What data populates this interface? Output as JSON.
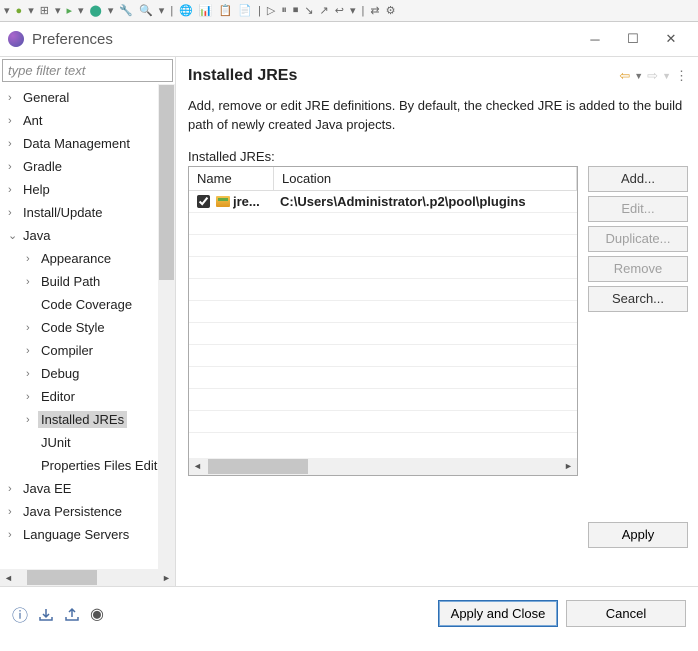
{
  "window": {
    "title": "Preferences"
  },
  "filter": {
    "placeholder": "type filter text"
  },
  "tree": {
    "items": [
      {
        "label": "General",
        "level": 0,
        "caret": ">"
      },
      {
        "label": "Ant",
        "level": 0,
        "caret": ">"
      },
      {
        "label": "Data Management",
        "level": 0,
        "caret": ">"
      },
      {
        "label": "Gradle",
        "level": 0,
        "caret": ">"
      },
      {
        "label": "Help",
        "level": 0,
        "caret": ">"
      },
      {
        "label": "Install/Update",
        "level": 0,
        "caret": ">"
      },
      {
        "label": "Java",
        "level": 0,
        "caret": "v",
        "expanded": true
      },
      {
        "label": "Appearance",
        "level": 1,
        "caret": ">"
      },
      {
        "label": "Build Path",
        "level": 1,
        "caret": ">"
      },
      {
        "label": "Code Coverage",
        "level": 1,
        "caret": ""
      },
      {
        "label": "Code Style",
        "level": 1,
        "caret": ">"
      },
      {
        "label": "Compiler",
        "level": 1,
        "caret": ">"
      },
      {
        "label": "Debug",
        "level": 1,
        "caret": ">"
      },
      {
        "label": "Editor",
        "level": 1,
        "caret": ">"
      },
      {
        "label": "Installed JREs",
        "level": 1,
        "caret": ">",
        "selected": true
      },
      {
        "label": "JUnit",
        "level": 1,
        "caret": ""
      },
      {
        "label": "Properties Files Editor",
        "level": 1,
        "caret": ""
      },
      {
        "label": "Java EE",
        "level": 0,
        "caret": ">"
      },
      {
        "label": "Java Persistence",
        "level": 0,
        "caret": ">"
      },
      {
        "label": "Language Servers",
        "level": 0,
        "caret": ">"
      }
    ]
  },
  "page": {
    "title": "Installed JREs",
    "description": "Add, remove or edit JRE definitions. By default, the checked JRE is added to the build path of newly created Java projects.",
    "tableLabel": "Installed JREs:",
    "columns": {
      "name": "Name",
      "location": "Location"
    },
    "rows": [
      {
        "checked": true,
        "name": "jre...",
        "location": "C:\\Users\\Administrator\\.p2\\pool\\plugins"
      }
    ],
    "buttons": {
      "add": "Add...",
      "edit": "Edit...",
      "duplicate": "Duplicate...",
      "remove": "Remove",
      "search": "Search..."
    }
  },
  "footer": {
    "apply": "Apply",
    "applyClose": "Apply and Close",
    "cancel": "Cancel"
  }
}
